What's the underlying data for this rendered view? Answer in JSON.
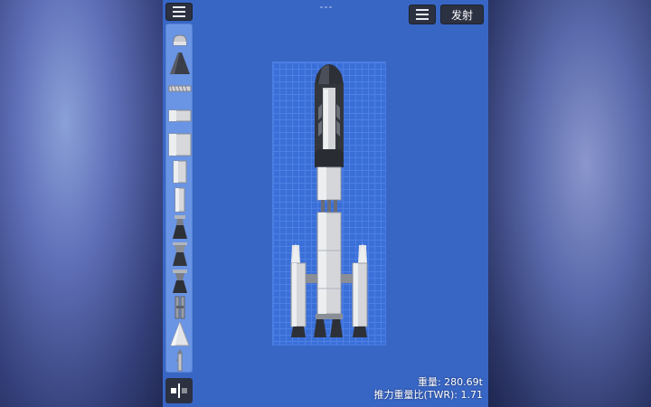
{
  "toolbar": {
    "left_menu_icon": "hamburger-icon",
    "right_menu_icon": "hamburger-icon",
    "launch_label": "发射"
  },
  "palette": {
    "items": [
      {
        "name": "capsule-part"
      },
      {
        "name": "nose-cone-part"
      },
      {
        "name": "docking-port-part"
      },
      {
        "name": "fuel-tank-short-part"
      },
      {
        "name": "fuel-tank-large-part"
      },
      {
        "name": "fuel-tank-medium-part"
      },
      {
        "name": "fuel-tank-thin-part"
      },
      {
        "name": "engine-small-part"
      },
      {
        "name": "engine-medium-part"
      },
      {
        "name": "engine-large-part"
      },
      {
        "name": "separator-part"
      },
      {
        "name": "cone-part"
      },
      {
        "name": "parachute-part"
      }
    ],
    "symmetry_icon": "symmetry-icon"
  },
  "stats": {
    "mass": "重量: 280.69t",
    "twr": "推力重量比(TWR): 1.71"
  },
  "colors": {
    "build_area": "#3866c4",
    "grid": "#3a6fd8",
    "palette": "#6a94e4",
    "button": "#2c3142",
    "tank": "#d4d6da"
  }
}
